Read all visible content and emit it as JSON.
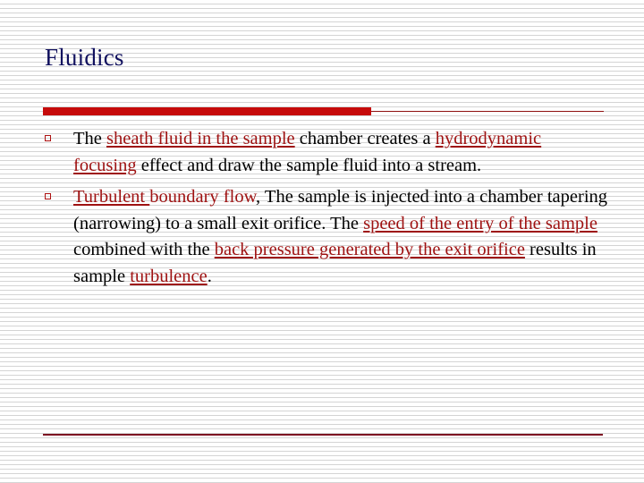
{
  "slide": {
    "title": "Fluidics",
    "accent_color_thick_bar": "#c60b0b",
    "accent_color_rule": "#8f1010",
    "title_color": "#11115e",
    "link_color": "#9e1111",
    "body_color": "#000000",
    "bottom_rule_color": "#7d1222",
    "bullet_marker_glyph": "hollow-square",
    "bullets": [
      {
        "id": "bullet-1",
        "segments": [
          {
            "text": "The ",
            "style": "plain"
          },
          {
            "text": "sheath fluid in the sample",
            "style": "link"
          },
          {
            "text": " chamber creates a ",
            "style": "plain"
          },
          {
            "text": "hydrodynamic focusing",
            "style": "link"
          },
          {
            "text": " effect and draw the sample fluid into a stream.",
            "style": "plain"
          }
        ],
        "plain_text": "The sheath fluid in the sample chamber creates a hydrodynamic focusing effect and draw the sample fluid into a stream."
      },
      {
        "id": "bullet-2",
        "segments": [
          {
            "text": "Turbulent ",
            "style": "link"
          },
          {
            "text": "boundary flow",
            "style": "red-plain"
          },
          {
            "text": ", The sample is injected into a chamber tapering (narrowing) to a small exit orifice. The ",
            "style": "plain"
          },
          {
            "text": "speed of the entry of the sample",
            "style": "link"
          },
          {
            "text": " combined with the ",
            "style": "plain"
          },
          {
            "text": "back pressure generated by the exit orifice",
            "style": "link"
          },
          {
            "text": " results in sample ",
            "style": "plain"
          },
          {
            "text": "turbulence",
            "style": "link"
          },
          {
            "text": ".",
            "style": "plain"
          }
        ],
        "plain_text": "Turbulent boundary flow, The sample is injected into a chamber tapering (narrowing) to a small exit orifice. The speed of the entry of the sample combined with the back pressure generated by the exit orifice results in sample turbulence."
      }
    ]
  }
}
